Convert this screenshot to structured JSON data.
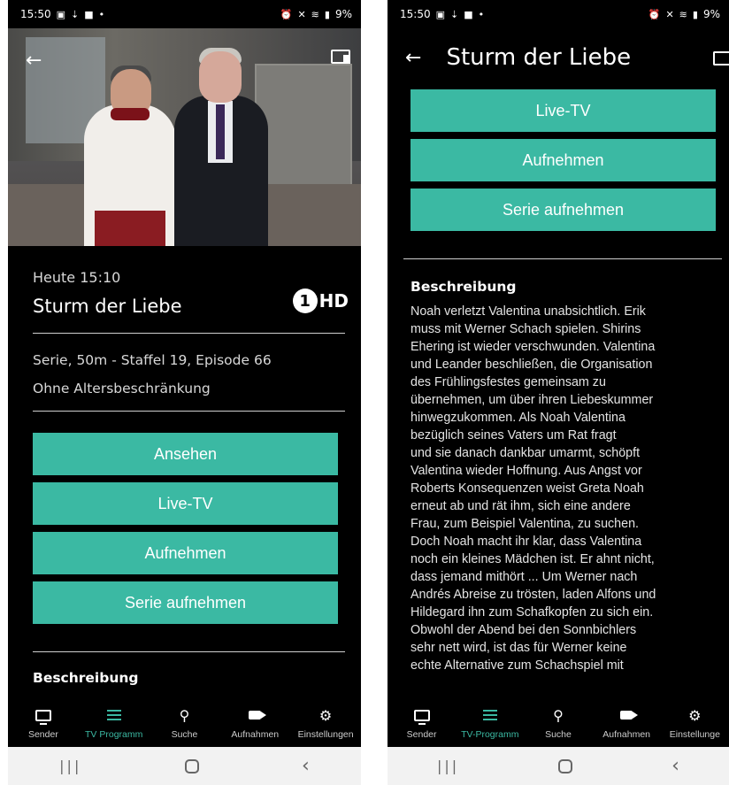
{
  "status_bar": {
    "time": "15:50",
    "battery": "9%"
  },
  "left": {
    "info": {
      "time": "Heute 15:10",
      "title": "Sturm der Liebe",
      "channel_number": "1",
      "channel_hd": "HD",
      "meta": "Serie, 50m - Staffel 19, Episode 66",
      "age_rating": "Ohne Altersbeschränkung"
    },
    "buttons": {
      "watch": "Ansehen",
      "live_tv": "Live-TV",
      "record": "Aufnehmen",
      "record_series": "Serie aufnehmen"
    },
    "description_heading": "Beschreibung",
    "nav": {
      "sender": "Sender",
      "tv_programm": "TV Programm",
      "suche": "Suche",
      "aufnahmen": "Aufnahmen",
      "einstellungen": "Einstellungen"
    }
  },
  "right": {
    "header_title": "Sturm der Liebe",
    "buttons": {
      "live_tv": "Live-TV",
      "record": "Aufnehmen",
      "record_series": "Serie aufnehmen"
    },
    "description_heading": "Beschreibung",
    "description_lines": [
      "Noah verletzt Valentina unabsichtlich. Erik",
      "muss mit Werner Schach spielen. Shirins",
      "Ehering ist wieder verschwunden. Valentina",
      "und Leander beschließen, die Organisation",
      "des Frühlingsfestes gemeinsam zu",
      "übernehmen, um über ihren Liebeskummer",
      "hinwegzukommen. Als Noah Valentina",
      "bezüglich seines Vaters um Rat fragt",
      "und sie danach dankbar umarmt, schöpft",
      "Valentina wieder Hoffnung. Aus Angst vor",
      "Roberts Konsequenzen weist Greta Noah",
      "erneut ab und rät ihm, sich eine andere",
      "Frau, zum Beispiel Valentina, zu suchen.",
      "Doch Noah macht ihr klar, dass Valentina",
      "noch ein kleines Mädchen ist. Er ahnt nicht,",
      "dass jemand mithört ... Um Werner nach",
      "Andrés Abreise zu trösten, laden Alfons und",
      "Hildegard ihn zum Schafkopfen zu sich ein.",
      "Obwohl der Abend bei den Sonnbichlers",
      "sehr nett wird, ist das für Werner keine",
      "echte Alternative zum Schachspiel mit"
    ],
    "nav": {
      "sender": "Sender",
      "tv_programm": "TV-Programm",
      "suche": "Suche",
      "aufnahmen": "Aufnahmen",
      "einstellungen": "Einstellunge"
    }
  },
  "colors": {
    "accent": "#3bb9a3",
    "background": "#000000"
  },
  "icons": {
    "back": "arrow-left-icon",
    "cast": "cast-icon",
    "sender": "tv-icon",
    "tv_programm": "list-icon",
    "suche": "search-icon",
    "aufnahmen": "video-camera-icon",
    "einstellungen": "gear-icon"
  }
}
